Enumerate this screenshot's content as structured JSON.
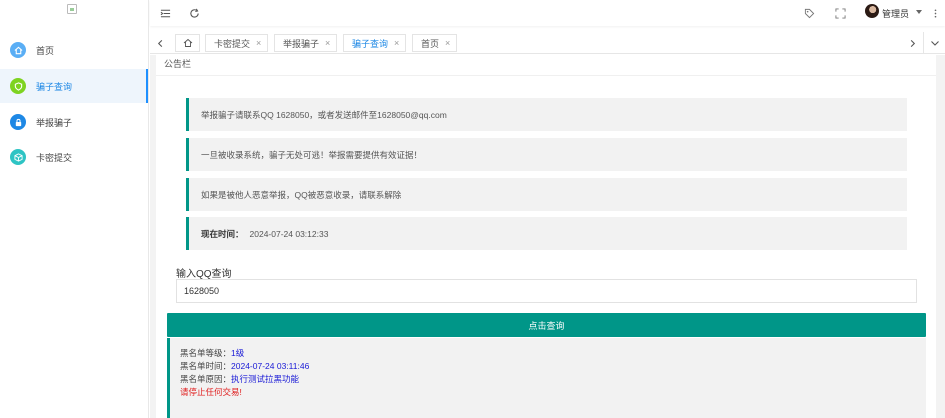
{
  "sidebar": {
    "items": [
      {
        "label": "首页",
        "color": "#5aaef5"
      },
      {
        "label": "骗子查询",
        "color": "#7ed321"
      },
      {
        "label": "举报骗子",
        "color": "#1e88e5"
      },
      {
        "label": "卡密提交",
        "color": "#2ec4c4"
      }
    ]
  },
  "header": {
    "user_name": "管理员"
  },
  "tabs": {
    "items": [
      {
        "label": "卡密提交",
        "close": "×"
      },
      {
        "label": "举报骗子",
        "close": "×"
      },
      {
        "label": "骗子查询",
        "close": "×"
      },
      {
        "label": "首页",
        "close": "×"
      }
    ]
  },
  "panel": {
    "title": "公告栏",
    "notices": [
      "举报骗子请联系QQ 1628050，或者发送邮件至1628050@qq.com",
      "一旦被收录系统，骗子无处可逃！举报需要提供有效证据！",
      "如果是被他人恶意举报，QQ被恶意收录，请联系解除"
    ],
    "time_label": "现在时间：",
    "time_value": "2024-07-24 03:12:33"
  },
  "query": {
    "label": "输入QQ查询",
    "value": "1628050",
    "button": "点击查询"
  },
  "result": {
    "level_key": "黑名单等级：",
    "level_value": "1级",
    "time_key": "黑名单时间：",
    "time_value": "2024-07-24 03:11:46",
    "reason_key": "黑名单原因：",
    "reason_value": "执行测试拉黑功能",
    "warning": "请停止任何交易!"
  },
  "colors": {
    "accent": "#009688",
    "active_link": "#1e88e5",
    "result_value": "#1a1ad6",
    "warning": "#e01c1c"
  },
  "icons": [
    "menu-fold-icon",
    "refresh-icon",
    "tag-icon",
    "fullscreen-icon",
    "more-vertical-icon",
    "home-icon",
    "chevron-left-icon",
    "chevron-right-icon",
    "chevron-down-icon"
  ]
}
